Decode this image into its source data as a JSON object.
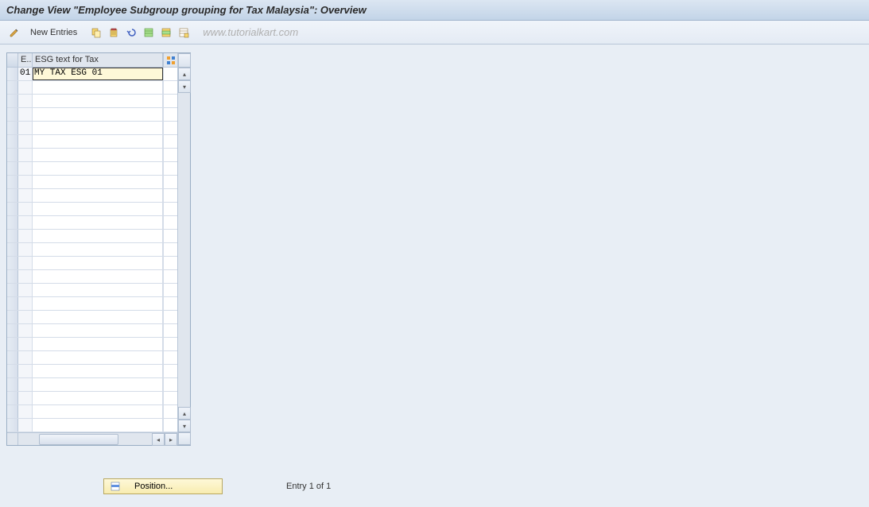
{
  "title": "Change View \"Employee Subgroup grouping for Tax Malaysia\": Overview",
  "toolbar": {
    "new_entries_label": "New Entries",
    "watermark": "www.tutorialkart.com"
  },
  "table": {
    "col_e_header": "E..",
    "col_esg_header": "ESG text for Tax",
    "rows": [
      {
        "e": "01",
        "esg": "MY TAX ESG 01"
      }
    ],
    "empty_row_count": 26
  },
  "footer": {
    "position_label": "Position...",
    "entry_text": "Entry 1 of 1"
  },
  "icons": {
    "edit": "edit-icon",
    "copy": "copy-icon",
    "delete": "delete-icon",
    "undo": "undo-icon",
    "select_all": "select-all-icon",
    "select_block": "select-block-icon",
    "deselect": "deselect-icon",
    "config": "config-icon"
  }
}
